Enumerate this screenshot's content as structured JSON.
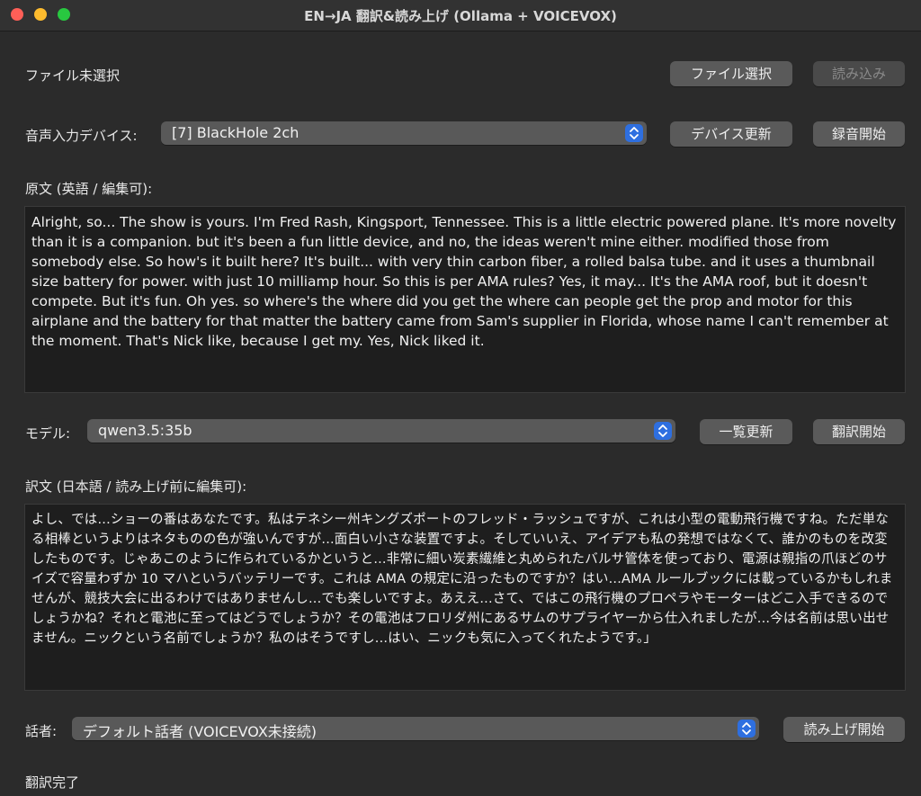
{
  "window": {
    "title": "EN→JA 翻訳&読み上げ (Ollama + VOICEVOX)"
  },
  "file": {
    "status": "ファイル未選択",
    "select_button": "ファイル選択",
    "load_button": "読み込み"
  },
  "audio": {
    "label": "音声入力デバイス:",
    "device": "[7] BlackHole 2ch",
    "refresh_button": "デバイス更新",
    "record_button": "録音開始"
  },
  "source": {
    "label": "原文 (英語 / 編集可):",
    "text": "Alright, so... The show is yours. I'm Fred Rash, Kingsport, Tennessee. This is a little electric powered plane. It's more novelty than it is a companion. but it's been a fun little device, and no, the ideas weren't mine either. modified those from somebody else. So how's it built here? It's built... with very thin carbon fiber, a rolled balsa tube. and it uses a thumbnail size battery for power. with just 10 milliamp hour. So this is per AMA rules? Yes, it may... It's the AMA roof, but it doesn't compete. But it's fun. Oh yes. so where's the where did you get the where can people get the prop and motor for this airplane and the battery for that matter the battery came from Sam's supplier in Florida, whose name I can't remember at the moment. That's Nick like, because I get my. Yes, Nick liked it."
  },
  "model": {
    "label": "モデル:",
    "value": "qwen3.5:35b",
    "refresh_button": "一覧更新",
    "translate_button": "翻訳開始"
  },
  "translation": {
    "label": "訳文 (日本語 / 読み上げ前に編集可):",
    "text": "よし、では...ショーの番はあなたです。私はテネシー州キングズポートのフレッド・ラッシュですが、これは小型の電動飛行機ですね。ただ単なる相棒というよりはネタものの色が強いんですが...面白い小さな装置ですよ。そしていいえ、アイデアも私の発想ではなくて、誰かのものを改変したものです。じゃあこのように作られているかというと...非常に細い炭素繊維と丸められたバルサ管体を使っており、電源は親指の爪ほどのサイズで容量わずか 10 マハというバッテリーです。これは AMA の規定に沿ったものですか？はい...AMA ルールブックには載っているかもしれませんが、競技大会に出るわけではありませんし...でも楽しいですよ。あええ...さて、ではこの飛行機のプロペラやモーターはどこ入手できるのでしょうかね？それと電池に至ってはどうでしょうか？その電池はフロリダ州にあるサムのサプライヤーから仕入れましたが...今は名前は思い出せません。ニックという名前でしょうか？私のはそうですし...はい、ニックも気に入ってくれたようです。」"
  },
  "speaker": {
    "label": "話者:",
    "value": "デフォルト話者 (VOICEVOX未接続)",
    "speak_button": "読み上げ開始"
  },
  "status": {
    "text": "翻訳完了"
  },
  "colors": {
    "background": "#2b2b2b",
    "button": "#5a5a5a",
    "accent": "#2e6fe0",
    "textarea": "#1e1e1e"
  }
}
